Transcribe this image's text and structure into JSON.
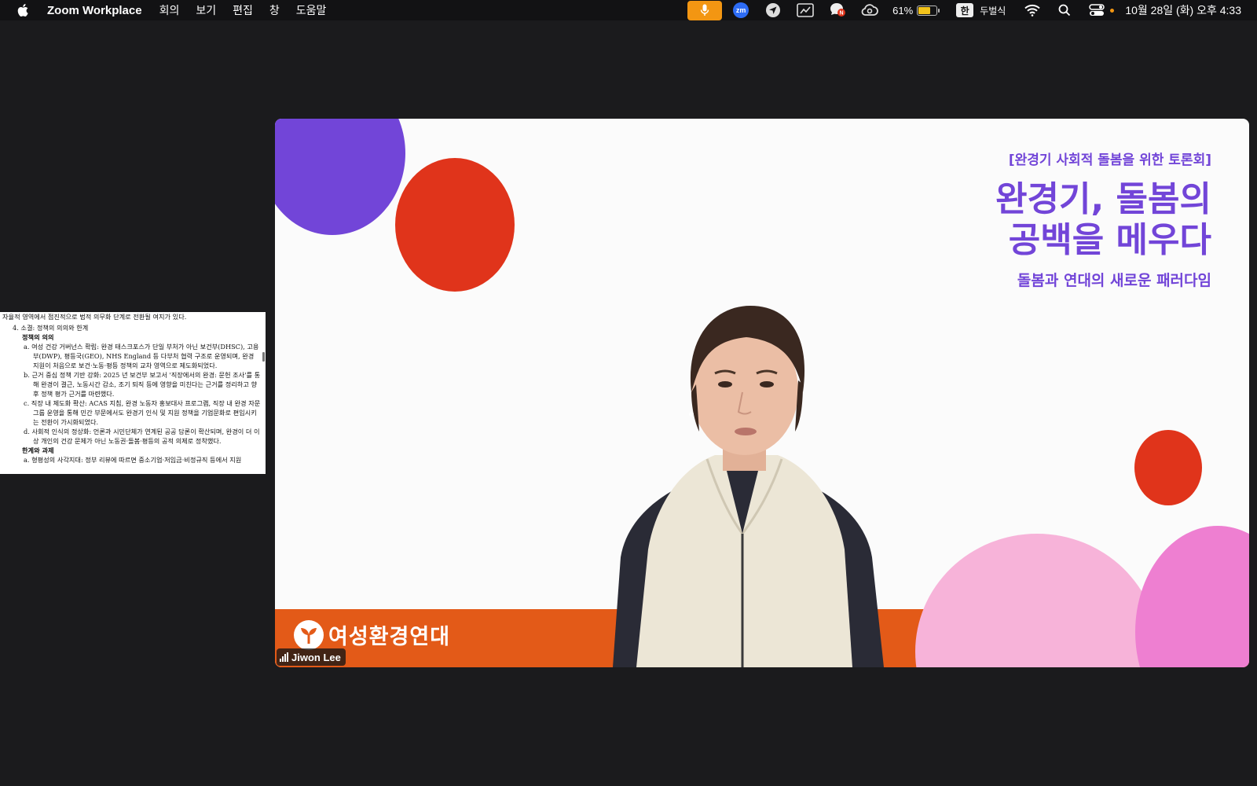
{
  "menubar": {
    "app_name": "Zoom Workplace",
    "menus": [
      "회의",
      "보기",
      "편집",
      "창",
      "도움말"
    ],
    "battery_percent": "61%",
    "battery_level": 0.61,
    "ime_badge": "한",
    "ime_name": "두벌식",
    "clock": "10월 28일 (화) 오후 4:33"
  },
  "video": {
    "participant_name": "Jiwon Lee",
    "slide": {
      "pretitle": "[완경기 사회적 돌봄을 위한 토론회]",
      "title_line1": "완경기, 돌봄의",
      "title_line2": "공백을 메우다",
      "subtitle": "돌봄과 연대의 새로운 패러다임",
      "org_name": "여성환경연대"
    },
    "colors": {
      "purple": "#7245d8",
      "red": "#e0341b",
      "orange": "#e35a18",
      "pink": "#f7b3d9",
      "magenta": "#ee7fd1"
    }
  },
  "document": {
    "line0": "자율적 영역에서 점진적으로 법적 의무화 단계로 전환될 여지가 있다.",
    "section": "4.  소결: 정책의 의의와 한계",
    "heading1": "정책의 의의",
    "items": [
      "a.  여성 건강 거버넌스 확립: 완경 태스크포스가 단일 부처가 아닌 보건부(DHSC), 고용부(DWP), 평등국(GEO), NHS England 등 다부처 협력 구조로 운영되며, 완경 지원이 처음으로 보건·노동·평등 정책의 교차 영역으로 제도화되었다.",
      "b.  근거 중심 정책 기반 강화: 2025 년 보건부 보고서 '직장에서의 완경: 문헌 조사'를 통해 완경이 결근, 노동시간 감소, 조기 퇴직 등에 영향을 미친다는 근거를 정리하고 향후 정책 평가 근거를 마련했다.",
      "c.  직장 내 제도화 확산: ACAS 지침, 완경 노동자 홍보대사 프로그램, 직장 내 완경 자문 그룹 운영을 통해 민간 부문에서도 완경기 인식 및 지원 정책을 기업문화로 편입시키는 전환이 가시화되었다.",
      "d.  사회적 인식의 정상화: 언론과 시민단체가 연계된 공공 담론이 확산되며, 완경이 더 이상 개인의 건강 문제가 아닌 노동권·돌봄·평등의 공적 의제로 정착했다."
    ],
    "heading2": "한계와 과제",
    "item_last": "a.  형평성의 사각지대: 정부 리뷰에 따르면 중소기업·저임금·비정규직 등에서 지원"
  }
}
